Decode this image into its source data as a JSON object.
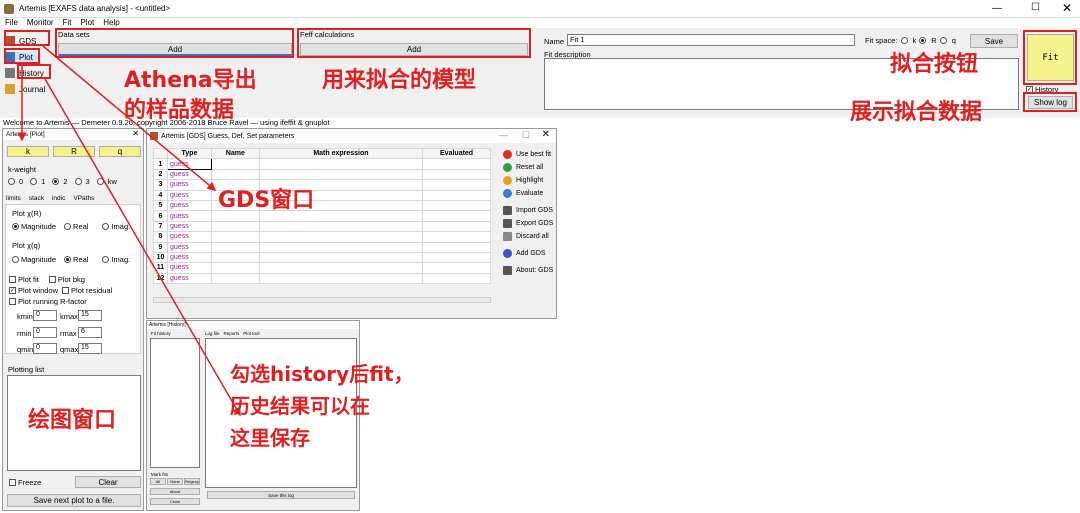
{
  "main": {
    "title": "Artemis [EXAFS data analysis] - <untitled>",
    "menu": [
      "File",
      "Monitor",
      "Fit",
      "Plot",
      "Help"
    ],
    "side": [
      "GDS",
      "Plot",
      "History",
      "Journal"
    ],
    "datasets_label": "Data sets",
    "datasets_add": "Add",
    "feff_label": "Feff calculations",
    "feff_add": "Add",
    "name_label": "Name",
    "name_value": "Fit 1",
    "fitspace_label": "Fit space:",
    "fitspace_opts": [
      "k",
      "R",
      "q"
    ],
    "save": "Save",
    "fit": "Fit",
    "fitdesc": "Fit description",
    "history": "History",
    "showlog": "Show log",
    "status": "Welcome to Artemis — Demeter 0.9.26, copyright 2006-2018 Bruce Ravel — using ifeffit & gnuplot"
  },
  "plot": {
    "title": "Artemis [Plot]",
    "kbtn": "k",
    "rbtn": "R",
    "qbtn": "q",
    "kweight": "k-weight",
    "kw_opts": [
      "0",
      "1",
      "2",
      "3",
      "kw"
    ],
    "tabs": [
      "limits",
      "stack",
      "indic",
      "VPaths"
    ],
    "plotR": "Plot χ(R)",
    "plotq": "Plot χ(q)",
    "mag": "Magnitude",
    "real": "Real",
    "imag": "Imag.",
    "cb": [
      "Plot fit",
      "Plot bkg",
      "Plot window",
      "Plot residual",
      "Plot running R-factor"
    ],
    "kmin": "kmin",
    "kmin_v": "0",
    "kmax": "kmax",
    "kmax_v": "15",
    "rmin": "rmin",
    "rmin_v": "0",
    "rmax": "rmax",
    "rmax_v": "6",
    "qmin": "qmin",
    "qmin_v": "0",
    "qmax": "qmax",
    "qmax_v": "15",
    "plotlist": "Plotting list",
    "freeze": "Freeze",
    "clear": "Clear",
    "savenext": "Save next plot to a file."
  },
  "gds": {
    "title": "Artemis [GDS] Guess, Def, Set parameters",
    "headers": [
      "Type",
      "Name",
      "Math expression",
      "Evaluated"
    ],
    "rows": [
      "1",
      "2",
      "3",
      "4",
      "5",
      "6",
      "7",
      "8",
      "9",
      "10",
      "11",
      "12"
    ],
    "type_val": "guess",
    "actions": [
      "Use best fit",
      "Reset all",
      "Highlight",
      "Evaluate",
      "Import GDS",
      "Export GDS",
      "Discard all",
      "Add GDS",
      "About: GDS"
    ],
    "action_colors": [
      "#d93025",
      "#2e9e3e",
      "#e0a020",
      "#3a7bd5",
      "#555555",
      "#555555",
      "#888888",
      "#3a55c8",
      "#555555"
    ]
  },
  "hist": {
    "title": "Artemis [History]",
    "fit_history": "Fit history",
    "tabs": [
      "Log file",
      "Reports",
      "Plot tool"
    ],
    "mark_fits": "Mark fits",
    "mark_btns": [
      "All",
      "None",
      "Regexp"
    ],
    "about": "About",
    "close": "Close",
    "save_log": "Save this log"
  },
  "annotations": {
    "a1": "Athena导出",
    "a2": "的样品数据",
    "a3": "用来拟合的模型",
    "a4": "拟合按钮",
    "a5": "展示拟合数据",
    "a6": "GDS窗口",
    "a7": "勾选history后fit，",
    "a8": "历史结果可以在",
    "a9": "这里保存",
    "a10": "绘图窗口"
  },
  "colors": {
    "fit_bg": "#f5f28c",
    "accent": "#3a6fc4",
    "red": "#e02020"
  }
}
